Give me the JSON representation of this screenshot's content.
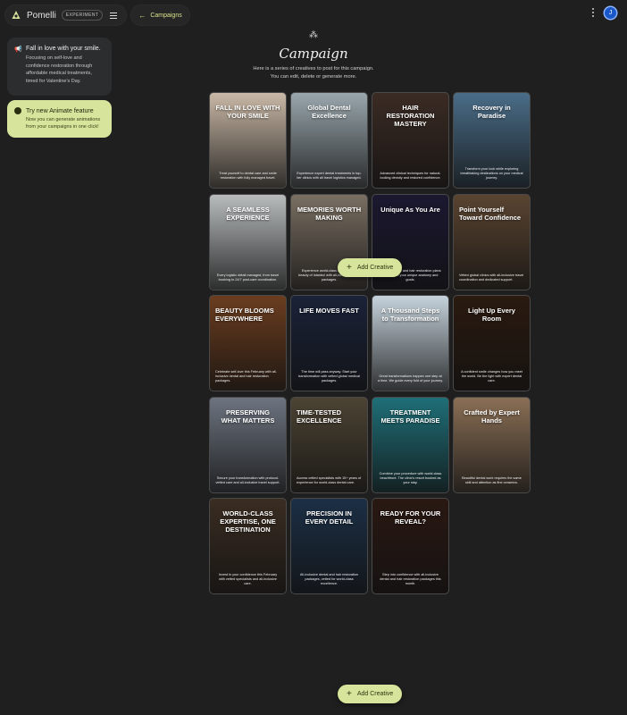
{
  "app": {
    "name": "Pomelli",
    "badge": "EXPERIMENT"
  },
  "breadcrumb": {
    "label": "Campaigns"
  },
  "user": {
    "initial": "J"
  },
  "notice": {
    "title": "Fall in love with your smile.",
    "body": "Focusing on self-love and confidence restoration through affordable medical treatments, timed for Valentine's Day."
  },
  "promo": {
    "title": "Try new Animate feature",
    "body": "Now you can generate animations from your campaigns in one click!"
  },
  "header": {
    "title": "Campaign",
    "subtitle_line1": "Here is a series of creatives to post for this campaign.",
    "subtitle_line2": "You can edit, delete or generate more."
  },
  "add_creative_label": "Add Creative",
  "cards": [
    {
      "headline": "FALL IN LOVE WITH YOUR SMILE",
      "body": "Treat yourself to dental care and smile restoration with fully managed travel.",
      "bg": "#c9b8a6"
    },
    {
      "headline": "Global Dental Excellence",
      "body": "Experience expert dental treatments in top-tier clinics with all travel logistics managed.",
      "bg": "#9aa7ad"
    },
    {
      "headline": "HAIR RESTORATION MASTERY",
      "body": "Advanced clinical techniques for natural-looking density and restored confidence.",
      "bg": "#3b2b24"
    },
    {
      "headline": "Recovery in Paradise",
      "body": "Transform your look while exploring breathtaking destinations on your medical journey.",
      "bg": "#4a6d88"
    },
    {
      "headline": "A SEAMLESS EXPERIENCE",
      "body": "Every logistic detail managed, from travel booking to 24/7 post-care coordination.",
      "bg": "#b8bcbd"
    },
    {
      "headline": "MEMORIES WORTH MAKING",
      "body": "Experience world-class care and the beauty of Istanbul with all-inclusive travel packages.",
      "bg": "#7a6f62"
    },
    {
      "headline": "Unique As You Are",
      "body": "Custom dental and hair restoration plans mapped to your unique anatomy and goals.",
      "bg": "#1b1830"
    },
    {
      "headline": "Point Yourself Toward Confidence",
      "body": "Vetted global clinics with all-inclusive travel coordination and dedicated support.",
      "bg": "#5a4431"
    },
    {
      "headline": "BEAUTY BLOOMS EVERYWHERE",
      "body": "Celebrate self-love this February with all-inclusive dental and hair restoration packages.",
      "bg": "#6b3d1f"
    },
    {
      "headline": "LIFE MOVES FAST",
      "body": "The time will pass anyway. Start your transformation with vetted global medical packages.",
      "bg": "#1a2238"
    },
    {
      "headline": "A Thousand Steps to Transformation",
      "body": "Great transformations happen one step at a time. We guide every fold of your journey.",
      "bg": "#c6d3dc"
    },
    {
      "headline": "Light Up Every Room",
      "body": "A confident smile changes how you meet the world. Be the light with expert dental care.",
      "bg": "#2a1a10"
    },
    {
      "headline": "PRESERVING WHAT MATTERS",
      "body": "Secure your transformation with protocol-vetted care and all-inclusive travel support.",
      "bg": "#6d7480"
    },
    {
      "headline": "TIME-TESTED EXCELLENCE",
      "body": "Access vetted specialists with 15+ years of experience for world-class dental care.",
      "bg": "#4c4333"
    },
    {
      "headline": "TREATMENT MEETS PARADISE",
      "body": "Combine your procedure with world-class beachfront. The clinic's resort booked as your stay.",
      "bg": "#1f6f78"
    },
    {
      "headline": "Crafted by Expert Hands",
      "body": "Beautiful dental work requires the same skill and attention as fine ceramics.",
      "bg": "#8a6f55"
    },
    {
      "headline": "WORLD-CLASS EXPERTISE, ONE DESTINATION",
      "body": "Invest in your confidence this February with vetted specialists and all-inclusive care.",
      "bg": "#3a2d22"
    },
    {
      "headline": "PRECISION IN EVERY DETAIL",
      "body": "All-inclusive dental and hair restoration packages, vetted for world-class excellence.",
      "bg": "#1c2f45"
    },
    {
      "headline": "READY FOR YOUR REVEAL?",
      "body": "Step into confidence with all-inclusive dental and hair restoration packages this month.",
      "bg": "#2a1812"
    }
  ],
  "colors": {
    "accent": "#d7e49b",
    "background": "#1f1f1f",
    "avatar": "#1a57c9"
  }
}
